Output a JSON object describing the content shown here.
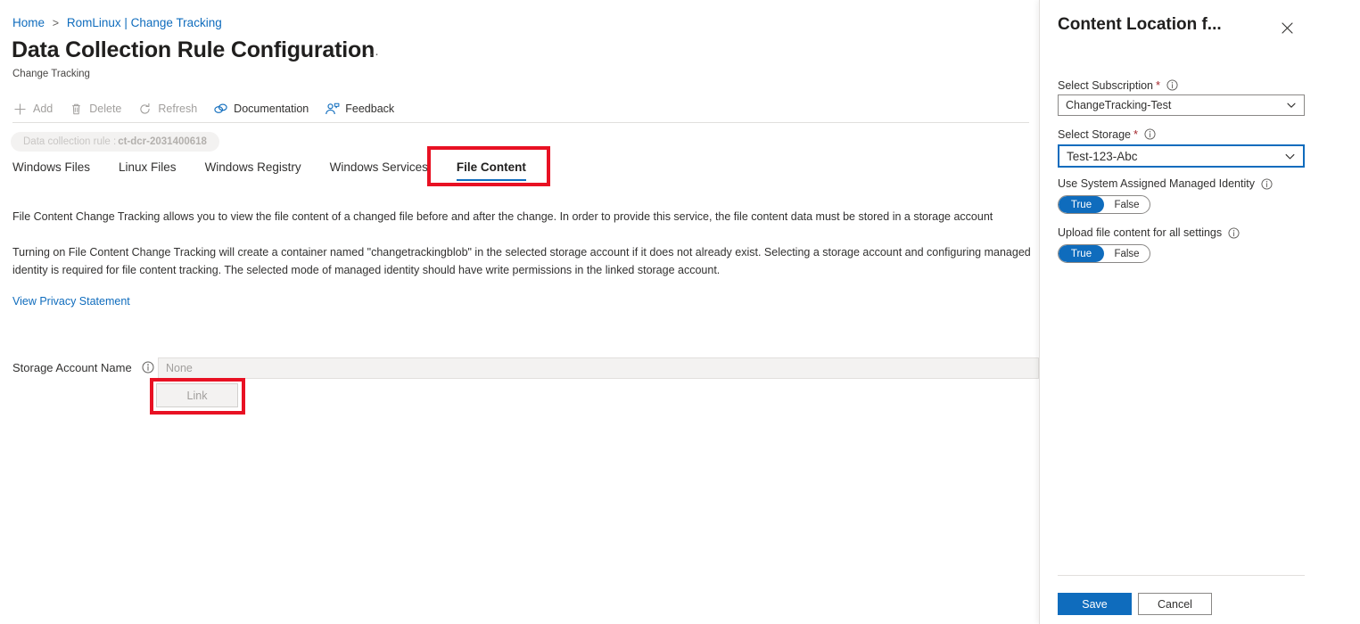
{
  "breadcrumb": {
    "home": "Home",
    "separator": ">",
    "current": "RomLinux | Change Tracking"
  },
  "header": {
    "title": "Data Collection Rule Configuration",
    "ellipsis": "···",
    "subtitle": "Change Tracking"
  },
  "command_bar": {
    "items": [
      {
        "label": "Add",
        "icon": "plus-icon",
        "state": "disabled"
      },
      {
        "label": "Delete",
        "icon": "trash-icon",
        "state": "disabled"
      },
      {
        "label": "Refresh",
        "icon": "refresh-icon",
        "state": "disabled"
      },
      {
        "label": "Documentation",
        "icon": "documentation-icon",
        "state": "enabled"
      },
      {
        "label": "Feedback",
        "icon": "feedback-icon",
        "state": "enabled"
      }
    ]
  },
  "chip": {
    "prefix": "Data collection rule :",
    "value": "ct-dcr-2031400618"
  },
  "tabs": [
    {
      "label": "Windows Files",
      "active": false
    },
    {
      "label": "Linux Files",
      "active": false
    },
    {
      "label": "Windows Registry",
      "active": false
    },
    {
      "label": "Windows Services",
      "active": false
    },
    {
      "label": "File Content",
      "active": true
    }
  ],
  "body": {
    "paragraph_1": "File Content Change Tracking allows you to view the file content of a changed file before and after the change. In order to provide this service, the file content data must be stored in a storage account",
    "paragraph_2": "Turning on File Content Change Tracking will create a container named \"changetrackingblob\" in the selected storage account if it does not already exist. Selecting a storage account and configuring managed identity is required for file content tracking. The selected mode of managed identity should have write permissions in the linked storage account.",
    "privacy_link": "View Privacy Statement"
  },
  "storage_row": {
    "label": "Storage Account Name",
    "info_icon": "info-icon",
    "input_placeholder": "None",
    "input_value": "",
    "link_button": "Link"
  },
  "side_panel": {
    "title": "Content Location f...",
    "close_icon": "close-icon",
    "fields": {
      "subscription": {
        "label": "Select Subscription",
        "required": true,
        "info_icon": "info-icon",
        "value": "ChangeTracking-Test",
        "chevron_icon": "chevron-down-icon"
      },
      "storage": {
        "label": "Select Storage",
        "required": true,
        "info_icon": "info-icon",
        "value": "Test-123-Abc",
        "chevron_icon": "chevron-down-icon"
      },
      "managed_identity": {
        "label": "Use System Assigned Managed Identity",
        "info_icon": "info-icon",
        "on_label": "True",
        "off_label": "False",
        "selected": "True"
      },
      "upload_all": {
        "label": "Upload file content for all settings",
        "info_icon": "info-icon",
        "on_label": "True",
        "off_label": "False",
        "selected": "True"
      }
    },
    "save_button": "Save",
    "cancel_button": "Cancel"
  },
  "colors": {
    "accent_blue": "#0f6cbd",
    "highlight_red": "#e81123",
    "required_red": "#a4262c",
    "disabled_gray": "#a19f9d",
    "text": "#323130"
  },
  "highlights": [
    {
      "name": "file-content-tab",
      "color": "#e81123"
    },
    {
      "name": "link-button",
      "color": "#e81123"
    }
  ]
}
